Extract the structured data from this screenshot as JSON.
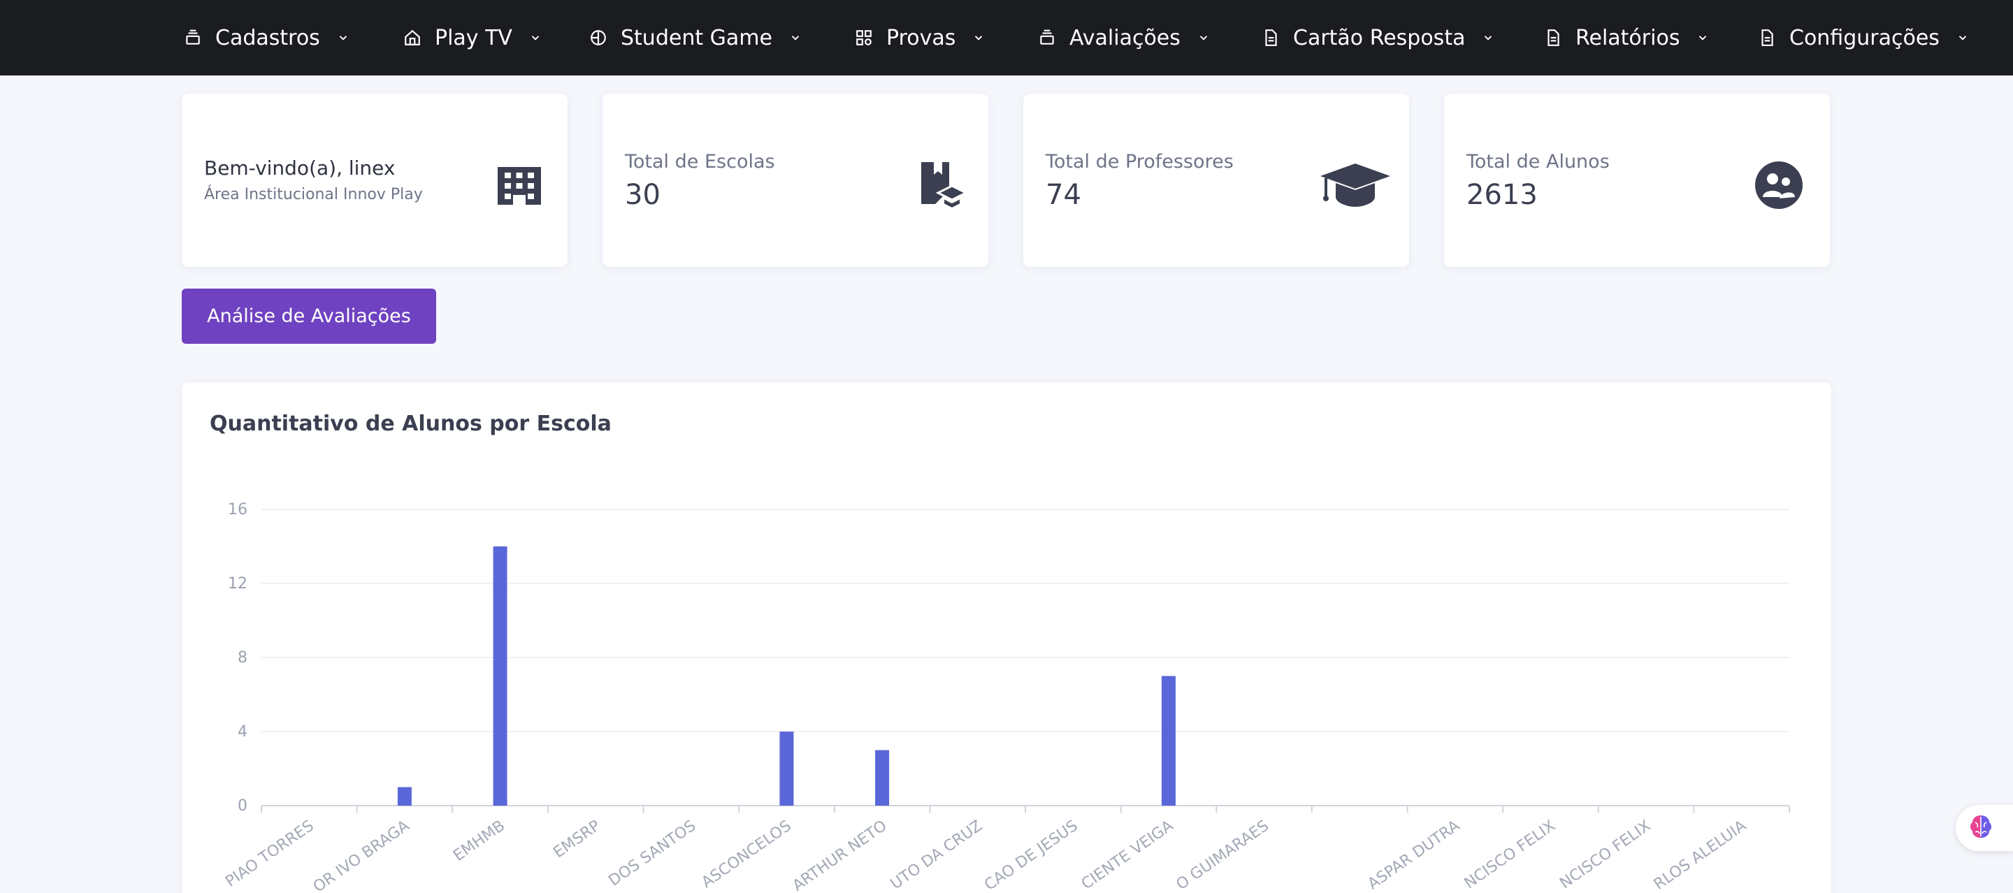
{
  "nav": {
    "items": [
      {
        "label": "Cadastros",
        "icon": "stack-icon"
      },
      {
        "label": "Play TV",
        "icon": "home-icon"
      },
      {
        "label": "Student Game",
        "icon": "globe-icon"
      },
      {
        "label": "Provas",
        "icon": "grid-icon"
      },
      {
        "label": "Avaliações",
        "icon": "stack-icon"
      },
      {
        "label": "Cartão Resposta",
        "icon": "document-icon"
      },
      {
        "label": "Relatórios",
        "icon": "document-icon"
      },
      {
        "label": "Configurações",
        "icon": "document-icon"
      }
    ]
  },
  "welcome": {
    "title": "Bem-vindo(a), linex",
    "subtitle": "Área Institucional Innov Play",
    "icon": "building-icon"
  },
  "stats": [
    {
      "title": "Total de Escolas",
      "value": "30",
      "icon": "book-graduation-icon"
    },
    {
      "title": "Total de Professores",
      "value": "74",
      "icon": "graduation-cap-icon"
    },
    {
      "title": "Total de Alunos",
      "value": "2613",
      "icon": "users-circle-icon"
    }
  ],
  "analyse_button": "Análise de Avaliações",
  "chart_title": "Quantitativo de Alunos por Escola",
  "chart_data": {
    "type": "bar",
    "title": "Quantitativo de Alunos por Escola",
    "categories": [
      "PIAO TORRES",
      "OR IVO BRAGA",
      "EMHMB",
      "EMSRP",
      "DOS SANTOS",
      "ASCONCELOS",
      "ARTHUR NETO",
      "UTO DA CRUZ",
      "CAO DE JESUS",
      "CIENTE VEIGA",
      "O GUIMARAES",
      "",
      "ASPAR DUTRA",
      "NCISCO FELIX",
      "NCISCO FELIX",
      "RLOS ALELUIA"
    ],
    "values": [
      0,
      1,
      14,
      0,
      0,
      4,
      3,
      0,
      0,
      7,
      0,
      0,
      0,
      0,
      0,
      0
    ],
    "yticks": [
      0,
      4,
      8,
      12,
      16
    ],
    "ylim": [
      0,
      16
    ],
    "grid": true,
    "bar_color": "#5a67d8"
  },
  "floating_icon": "brain-icon",
  "colors": {
    "nav_bg": "#1a1c20",
    "accent": "#6f42c1",
    "bar": "#5a67d8"
  }
}
